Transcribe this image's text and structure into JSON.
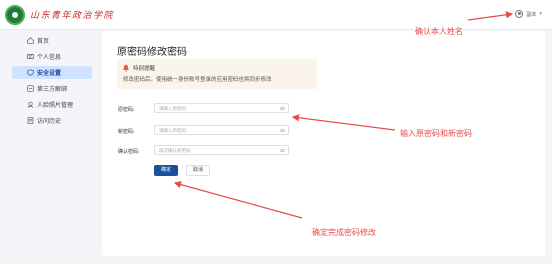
{
  "header": {
    "school_name": "山东青年政治学院",
    "user_name": "副本",
    "user_icon": "user-icon",
    "dropdown_icon": "chevron-down-icon"
  },
  "sidebar": {
    "items": [
      {
        "label": "首页",
        "icon": "home-icon",
        "active": false
      },
      {
        "label": "个人信息",
        "icon": "id-card-icon",
        "active": false
      },
      {
        "label": "安全设置",
        "icon": "shield-icon",
        "active": true
      },
      {
        "label": "第三方解绑",
        "icon": "unlink-icon",
        "active": false
      },
      {
        "label": "人脸照片管理",
        "icon": "face-icon",
        "active": false
      },
      {
        "label": "访问历史",
        "icon": "history-icon",
        "active": false
      }
    ]
  },
  "main": {
    "title": "原密码修改密码",
    "notice": {
      "icon": "bell-icon",
      "title": "特别提醒",
      "text": "修改密码后，使用统一身份账号登录的应用密码也将同步修改"
    },
    "form": {
      "old_password": {
        "label": "原密码:",
        "placeholder": "请输入原密码"
      },
      "new_password": {
        "label": "新密码:",
        "placeholder": "请输入新密码"
      },
      "confirm_password": {
        "label": "确认密码:",
        "placeholder": "再次确认新密码"
      }
    },
    "confirm_label": "确定",
    "cancel_label": "取消"
  },
  "annotations": {
    "verify_name": "确认本人姓名",
    "enter_passwords": "输入原密码和新密码",
    "confirm_change": "确定完成密码修改"
  },
  "colors": {
    "accent": "#1b4f9c",
    "active_bg": "#cfe3ff",
    "annotation": "#e84b4b",
    "notice_bg": "#fbf4ea"
  }
}
